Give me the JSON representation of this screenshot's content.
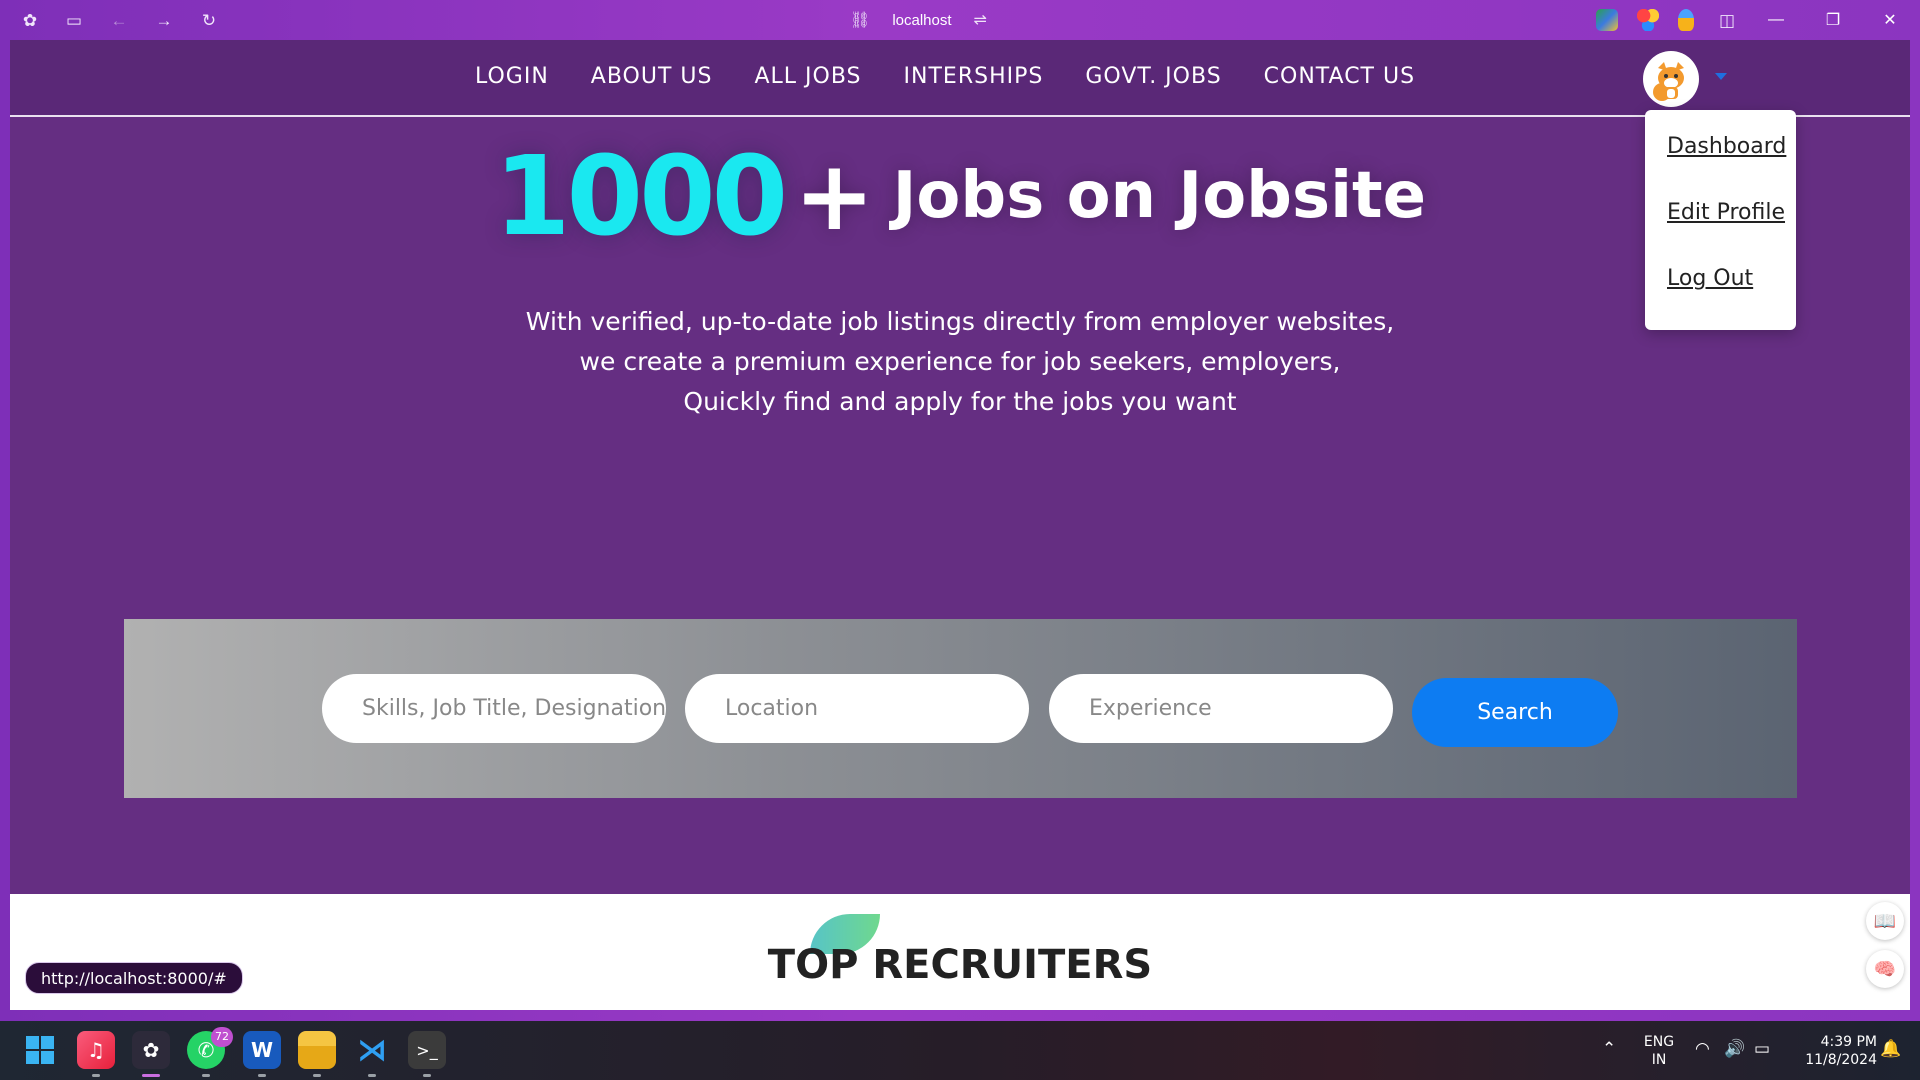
{
  "browser": {
    "url": "localhost",
    "status_url": "http://localhost:8000/#"
  },
  "nav": {
    "links": [
      "LOGIN",
      "ABOUT US",
      "ALL JOBS",
      "INTERSHIPS",
      "GOVT. JOBS",
      "CONTACT US"
    ]
  },
  "profile_menu": {
    "items": [
      "Dashboard",
      "Edit Profile",
      "Log Out"
    ]
  },
  "hero": {
    "count": "1000",
    "plus": "+",
    "title_rest": "Jobs on Jobsite",
    "subtitle_lines": [
      "With verified, up-to-date job listings directly from employer websites,",
      "we create a premium experience for job seekers, employers,",
      "Quickly find and apply for the jobs you want"
    ]
  },
  "search": {
    "skills_placeholder": "Skills, Job Title, Designation",
    "location_placeholder": "Location",
    "experience_placeholder": "Experience",
    "button_label": "Search"
  },
  "recruiters": {
    "title": "TOP RECRUITERS"
  },
  "taskbar": {
    "whatsapp_badge": "72",
    "lang_line1": "ENG",
    "lang_line2": "IN",
    "time": "4:39 PM",
    "date": "11/8/2024"
  },
  "colors": {
    "accent_cyan": "#1ae8f0",
    "search_button": "#0d7cf2",
    "page_bg": "#652e82"
  }
}
